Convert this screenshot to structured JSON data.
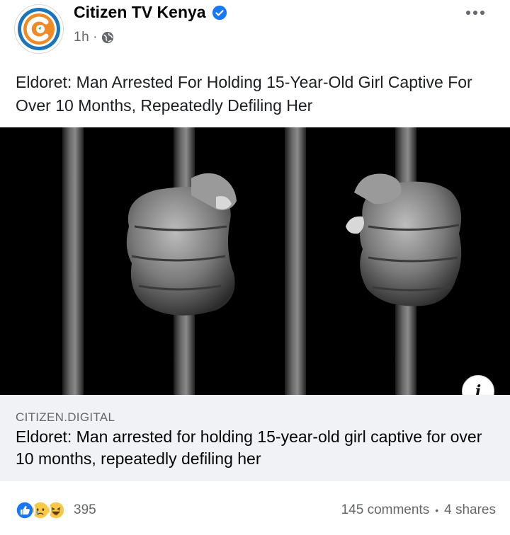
{
  "post": {
    "page_name": "Citizen TV Kenya",
    "time": "1h",
    "separator": "·",
    "text": "Eldoret: Man Arrested For Holding 15-Year-Old Girl Captive For Over 10 Months, Repeatedly Defiling Her"
  },
  "link": {
    "domain": "CITIZEN.DIGITAL",
    "title": "Eldoret: Man arrested for holding 15-year-old girl captive for over 10 months, repeatedly defiling her"
  },
  "footer": {
    "reaction_count": "395",
    "comments": "145 comments",
    "dot": "•",
    "shares": "4 shares",
    "reactions": [
      "like-icon",
      "sad-icon",
      "haha-icon"
    ]
  },
  "icons": {
    "verified": "verified-badge-icon",
    "audience": "globe-icon",
    "menu": "more-options-icon",
    "info": "info-icon"
  },
  "colors": {
    "fb_blue": "#1877f2",
    "secondary_text": "#65676b",
    "preview_bg": "#f0f2f5",
    "logo_orange": "#f08a24",
    "logo_blue": "#1a75bb"
  },
  "info_glyph": "i"
}
